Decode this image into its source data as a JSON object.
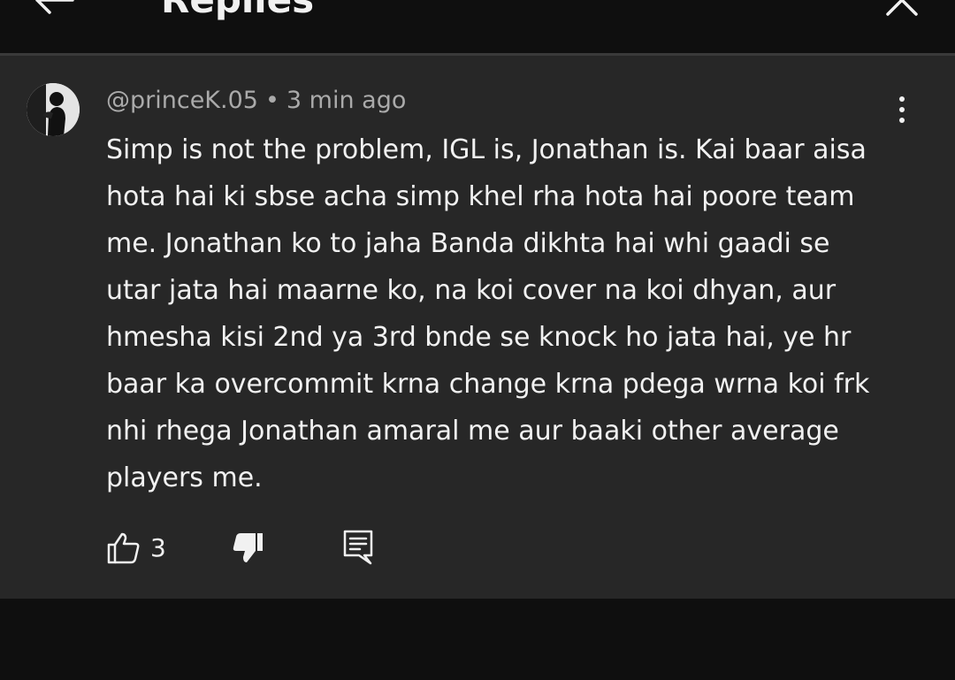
{
  "header": {
    "title": "Replies",
    "back_icon": "arrow-left-icon",
    "close_icon": "close-icon"
  },
  "comment": {
    "author": "@princeK.05",
    "separator": "•",
    "time": "3 min ago",
    "text": "Simp is not the problem, IGL is, Jonathan is. Kai baar aisa hota hai ki sbse acha simp khel rha hota hai poore team me. Jonathan ko to jaha Banda dikhta hai whi gaadi se utar jata hai maarne ko, na koi cover na koi dhyan, aur hmesha kisi 2nd ya 3rd bnde se knock ho jata hai, ye hr baar ka overcommit krna change krna pdega wrna koi frk nhi rhega Jonathan amaral me aur baaki other average players me.",
    "like_count": "3",
    "icons": {
      "avatar": "avatar",
      "more": "more-vertical-icon",
      "like": "thumbs-up-icon",
      "dislike": "thumbs-down-icon",
      "reply": "reply-comment-icon"
    }
  },
  "colors": {
    "background": "#0f0f0f",
    "card": "#272727",
    "text": "#f1f1f1",
    "secondary_text": "#aaaaaa",
    "divider": "#3a3a3a"
  }
}
